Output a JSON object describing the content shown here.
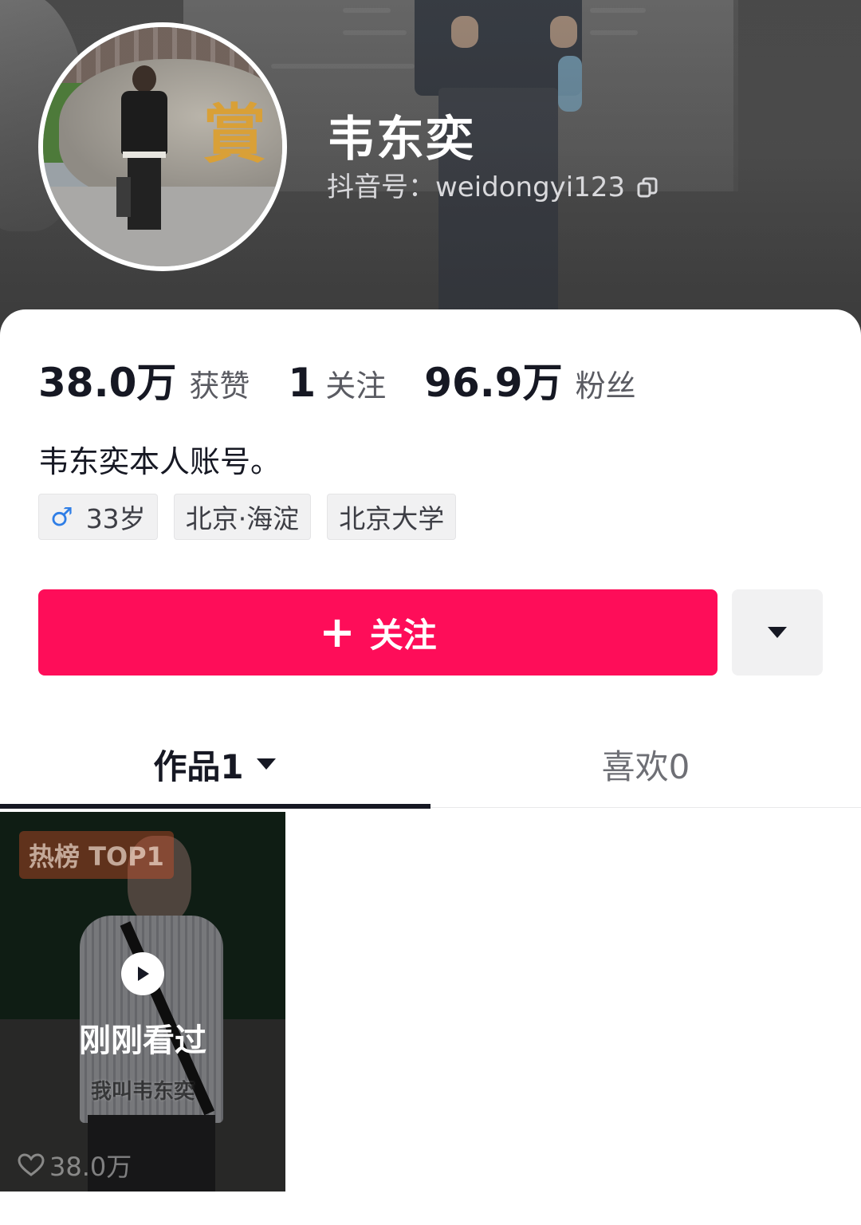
{
  "profile": {
    "name": "韦东奕",
    "douyin_id": "抖音号：weidongyi123",
    "bio": "韦东奕本人账号。"
  },
  "stats": [
    {
      "value": "38.0万",
      "label": "获赞"
    },
    {
      "value": "1",
      "label": "关注"
    },
    {
      "value": "96.9万",
      "label": "粉丝"
    }
  ],
  "tags": {
    "gender_symbol": "♂",
    "age": "33岁",
    "location": "北京·海淀",
    "school": "北京大学"
  },
  "actions": {
    "follow_plus": "+",
    "follow_label": "关注"
  },
  "tabs": {
    "works": "作品1",
    "likes": "喜欢0"
  },
  "video": {
    "badge": "热榜 TOP1",
    "watched": "刚刚看过",
    "caption": "我叫韦东奕",
    "likes": "38.0万"
  },
  "colors": {
    "accent": "#fe0d59",
    "gender": "#2f7ee6",
    "text": "#161823"
  }
}
